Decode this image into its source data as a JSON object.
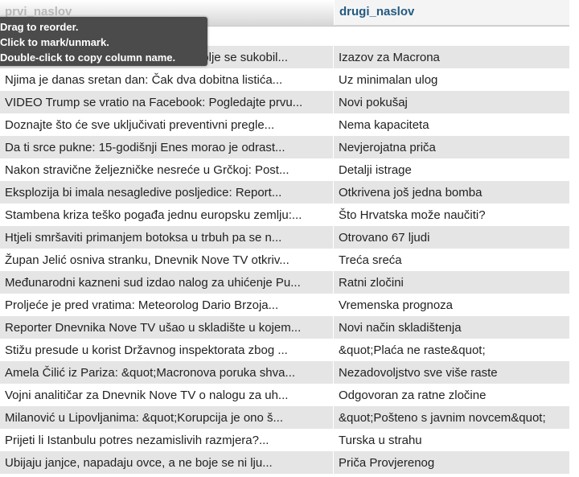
{
  "header": {
    "col1": "prvi_naslov",
    "col2": "drugi_naslov"
  },
  "tooltip": {
    "line1": "Drag to reorder.",
    "line2": "Click to mark/unmark.",
    "line3": "Double-click to copy column name."
  },
  "rows": [
    {
      "c1": "Njima je danas sretan dan: Čak dva dobitna listića...",
      "c2": "Uz minimalan ulog"
    },
    {
      "c1": "VIDEO Trump se vratio na Facebook: Pogledajte prvu...",
      "c2": "Novi pokušaj"
    },
    {
      "c1": "Doznajte što će sve uključivati preventivni pregle...",
      "c2": "Nema kapaciteta"
    },
    {
      "c1": "Da ti srce pukne: 15-godišnji Enes morao je odrast...",
      "c2": "Nevjerojatna priča"
    },
    {
      "c1": "Nakon stravične željezničke nesreće u Grčkoj: Post...",
      "c2": "Detalji istrage"
    },
    {
      "c1": "Eksplozija bi imala nesagledive posljedice: Report...",
      "c2": "Otkrivena još jedna bomba"
    },
    {
      "c1": "Stambena kriza teško pogađa jednu europsku zemlju:...",
      "c2": "Što Hrvatska može naučiti?"
    },
    {
      "c1": "Htjeli smršaviti primanjem botoksa u trbuh pa se n...",
      "c2": "Otrovano 67 ljudi"
    },
    {
      "c1": "Župan Jelić osniva stranku, Dnevnik Nove TV otkriv...",
      "c2": "Treća sreća"
    },
    {
      "c1": "Međunarodni kazneni sud izdao nalog za uhićenje Pu...",
      "c2": "Ratni zločini"
    },
    {
      "c1": "Proljeće je pred vratima: Meteorolog Dario Brzoja...",
      "c2": "Vremenska prognoza"
    },
    {
      "c1": "Reporter Dnevnika Nove TV ušao u skladište u kojem...",
      "c2": "Novi način skladištenja"
    },
    {
      "c1": "Stižu presude u korist Državnog inspektorata zbog ...",
      "c2": "&quot;Plaća ne raste&quot;"
    },
    {
      "c1": "Amela Čilić iz Pariza: &quot;Macronova poruka shva...",
      "c2": "Nezadovoljstvo sve više raste"
    },
    {
      "c1": "Vojni analitičar za Dnevnik Nove TV o nalogu za uh...",
      "c2": "Odgovoran za ratne zločine"
    },
    {
      "c1": "Milanović u Lipovljanima: &quot;Korupcija je ono š...",
      "c2": "&quot;Pošteno s javnim novcem&quot;"
    },
    {
      "c1": "Prijeti li Istanbulu potres nezamislivih razmjera?...",
      "c2": "Turska u strahu"
    },
    {
      "c1": "Ubijaju janjce, napadaju ovce, a ne boje se ni lju...",
      "c2": "Priča Provjerenog"
    }
  ],
  "partial_row": {
    "c1": "Dolje se sukobil...",
    "c2": "Izazov za Macrona"
  }
}
